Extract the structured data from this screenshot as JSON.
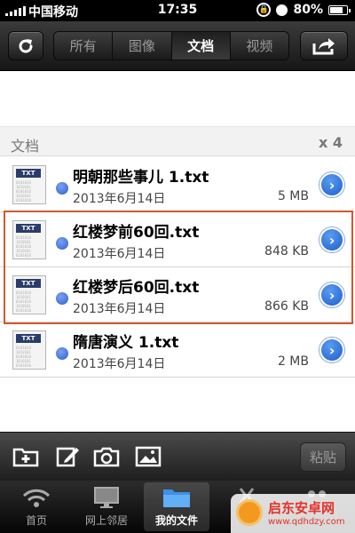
{
  "status_bar": {
    "carrier": "中国移动",
    "time": "17:35",
    "battery": "80%",
    "battery_level": 0.8
  },
  "toolbar": {
    "tabs": [
      {
        "label": "所有",
        "active": false
      },
      {
        "label": "图像",
        "active": false
      },
      {
        "label": "文档",
        "active": true
      },
      {
        "label": "视频",
        "active": false
      }
    ],
    "refresh_icon": "refresh-icon",
    "share_icon": "share-icon"
  },
  "section": {
    "title": "文档",
    "count": "x 4"
  },
  "files": [
    {
      "type_tag": "TXT",
      "name": "明朝那些事儿 1.txt",
      "date": "2013年6月14日",
      "size": "5 MB"
    },
    {
      "type_tag": "TXT",
      "name": "红楼梦前60回.txt",
      "date": "2013年6月14日",
      "size": "848 KB"
    },
    {
      "type_tag": "TXT",
      "name": "红楼梦后60回.txt",
      "date": "2013年6月14日",
      "size": "866 KB"
    },
    {
      "type_tag": "TXT",
      "name": "隋唐演义 1.txt",
      "date": "2013年6月14日",
      "size": "2 MB"
    }
  ],
  "action_bar": {
    "icons": [
      "new-folder-icon",
      "edit-icon",
      "camera-icon",
      "photo-icon"
    ],
    "paste_label": "粘贴"
  },
  "tab_bar": {
    "tabs": [
      {
        "label": "首页",
        "icon": "wifi-icon",
        "active": false
      },
      {
        "label": "网上邻居",
        "icon": "monitor-icon",
        "active": false
      },
      {
        "label": "我的文件",
        "icon": "folder-icon",
        "active": true
      },
      {
        "label": "",
        "icon": "settings-icon",
        "active": false
      },
      {
        "label": "",
        "icon": "more-icon",
        "active": false
      }
    ]
  },
  "watermark": {
    "title": "启东安卓网",
    "url": "www.qdhdzy.com"
  },
  "colors": {
    "highlight": "#d2572e",
    "accent": "#2f5fcf"
  }
}
